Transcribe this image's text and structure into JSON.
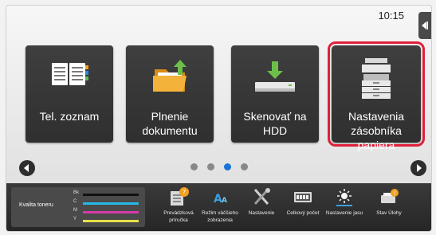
{
  "status": {
    "time": "10:15"
  },
  "tiles": [
    {
      "label_lines": [
        "Tel. zoznam"
      ],
      "icon": "address-book-icon",
      "selected": false
    },
    {
      "label_lines": [
        "Plnenie",
        "dokumentu"
      ],
      "icon": "document-filing-icon",
      "selected": false
    },
    {
      "label_lines": [
        "Skenovať na",
        "HDD"
      ],
      "icon": "scan-to-hdd-icon",
      "selected": false
    },
    {
      "label_lines": [
        "Nastavenia",
        "zásobníka papiera"
      ],
      "icon": "printer-tray-icon",
      "selected": true
    }
  ],
  "pager": {
    "count": 4,
    "active_index": 2
  },
  "toner": {
    "title": "Kvalita toneru",
    "channels": [
      {
        "label": "Bk",
        "color": "#111111",
        "level": 1.0
      },
      {
        "label": "C",
        "color": "#25b8e8",
        "level": 1.0
      },
      {
        "label": "M",
        "color": "#d63aa8",
        "level": 1.0
      },
      {
        "label": "Y",
        "color": "#e8e04a",
        "level": 1.0
      }
    ]
  },
  "actions": [
    {
      "label": "Prevádzková príručka",
      "icon": "manual-icon"
    },
    {
      "label": "Režim väčšieho zobrazenia",
      "icon": "large-display-icon"
    },
    {
      "label": "Nastavenie",
      "icon": "settings-tools-icon"
    },
    {
      "label": "Celkový počet",
      "icon": "counter-icon"
    },
    {
      "label": "Nastavenie jasu",
      "icon": "brightness-icon"
    },
    {
      "label": "Stav Úlohy",
      "icon": "job-status-icon"
    }
  ],
  "colors": {
    "accent": "#1a73d8",
    "highlight": "#e0203a"
  }
}
